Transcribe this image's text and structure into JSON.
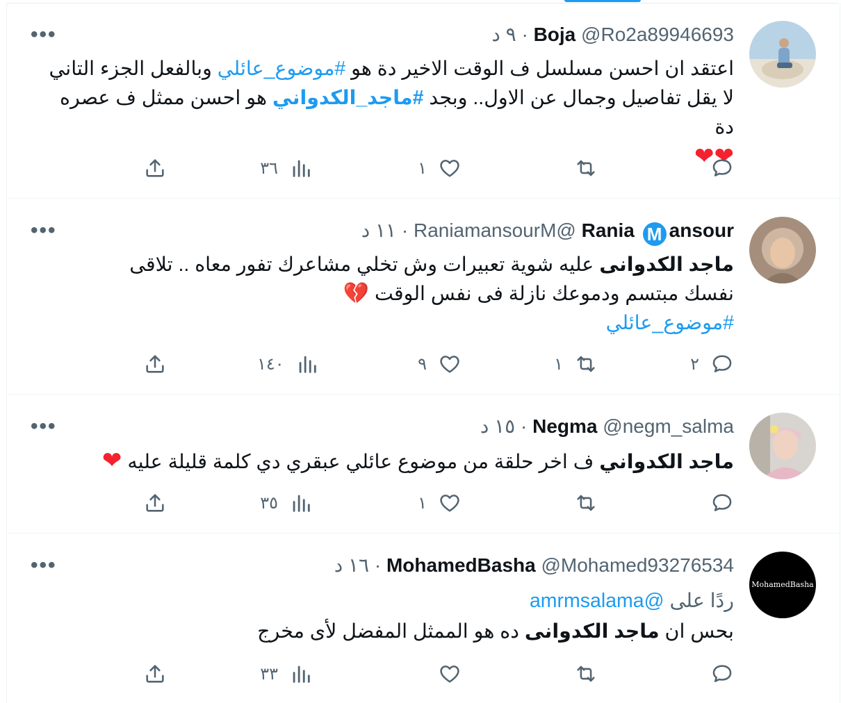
{
  "colors": {
    "accent": "#1d9bf0",
    "muted": "#536471",
    "heart": "#f4212e"
  },
  "icons": {
    "reply": "reply-icon",
    "retweet": "retweet-icon",
    "like": "like-icon",
    "views": "views-icon",
    "share": "share-icon",
    "more": "more-icon"
  },
  "tweets": [
    {
      "name": "Boja",
      "handle": "@Ro2a89946693",
      "sep": "·",
      "time": "٩ د",
      "text1": "اعتقد ان احسن مسلسل ف الوقت الاخير دة هو ",
      "tag1": "#موضوع_عائلي",
      "text2": " وبالفعل الجزء التاني لا يقل تفاصيل وجمال عن الاول.. وبجد ",
      "tag2": "#ماجد_الكدواني",
      "text3": " هو احسن ممثل ف عصره دة",
      "emoji": "❤❤",
      "reply_count": "",
      "retweet_count": "",
      "like_count": "١",
      "view_count": "٣٦"
    },
    {
      "name_a": "Rania",
      "badge": "M",
      "name_b": "ansour",
      "handle": "@RaniamansourM",
      "sep": "·",
      "time": "١١ د",
      "bold": "ماجد الكدوانى",
      "text1": " عليه شوية تعبيرات وش تخلي مشاعرك تفور معاه .. تلاقى نفسك مبتسم ودموعك نازلة فى نفس الوقت ",
      "emoji": "💔",
      "tag1": "#موضوع_عائلي",
      "reply_count": "٢",
      "retweet_count": "١",
      "like_count": "٩",
      "view_count": "١٤٠"
    },
    {
      "name": "Negma",
      "handle": "@negm_salma",
      "sep": "·",
      "time": "١٥ د",
      "bold": "ماجد الكدواني",
      "text1": " ف اخر حلقة من موضوع عائلي  عبقري دي كلمة قليلة عليه ",
      "emoji": "❤",
      "reply_count": "",
      "retweet_count": "",
      "like_count": "١",
      "view_count": "٣٥"
    },
    {
      "name": "MohamedBasha",
      "handle": "@Mohamed93276534",
      "sep": "·",
      "time": "١٦ د",
      "reply_to_label": "ردًا على ",
      "reply_to_handle": "@amrmsalama",
      "text1": "بحس ان ",
      "bold": "ماجد الكدوانى",
      "text2": " ده هو الممثل المفضل لأى مخرج",
      "avatar_text": "MohamedBasha",
      "reply_count": "",
      "retweet_count": "",
      "like_count": "",
      "view_count": "٣٣"
    }
  ]
}
